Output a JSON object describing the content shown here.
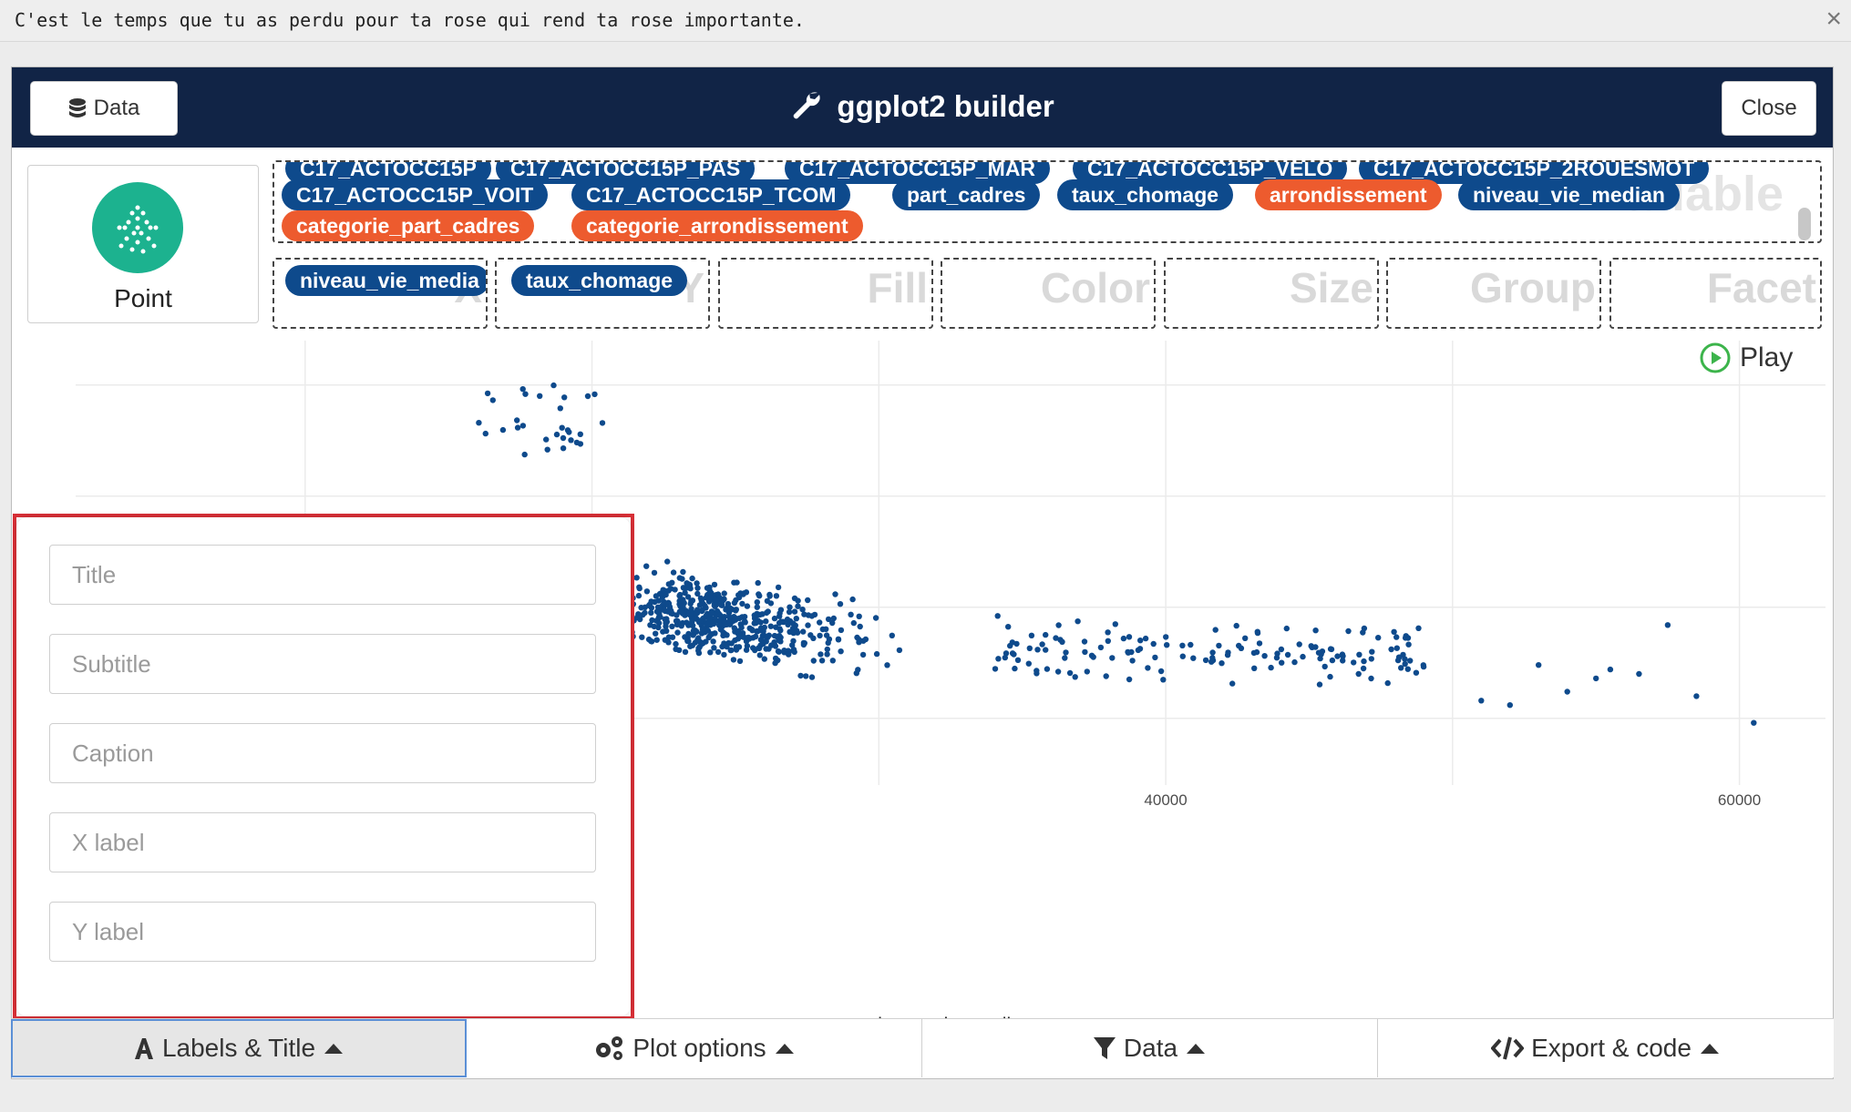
{
  "banner": {
    "text": "C'est le temps que tu as perdu pour ta rose qui rend ta rose importante.",
    "close_glyph": "×"
  },
  "header": {
    "title": "ggplot2 builder",
    "data_button": "Data",
    "close_button": "Close",
    "bg_color": "#112446"
  },
  "geom": {
    "label": "Point",
    "icon": "point-geom-icon",
    "color": "#1cb28f"
  },
  "variables": {
    "ghost_label": "ariable",
    "chips": [
      {
        "label": "C17_ACTOCC15P",
        "color": "blue"
      },
      {
        "label": "C17_ACTOCC15P_PAS",
        "color": "blue"
      },
      {
        "label": "C17_ACTOCC15P_MAR",
        "color": "blue"
      },
      {
        "label": "C17_ACTOCC15P_VELO",
        "color": "blue"
      },
      {
        "label": "C17_ACTOCC15P_2ROUESMOT",
        "color": "blue"
      },
      {
        "label": "C17_ACTOCC15P_VOIT",
        "color": "blue"
      },
      {
        "label": "C17_ACTOCC15P_TCOM",
        "color": "blue"
      },
      {
        "label": "part_cadres",
        "color": "blue"
      },
      {
        "label": "taux_chomage",
        "color": "blue"
      },
      {
        "label": "arrondissement",
        "color": "orange"
      },
      {
        "label": "niveau_vie_median",
        "color": "blue"
      },
      {
        "label": "categorie_part_cadres",
        "color": "orange"
      },
      {
        "label": "categorie_arrondissement",
        "color": "orange"
      }
    ]
  },
  "zones": {
    "x": {
      "label": "X",
      "chip": "niveau_vie_media"
    },
    "y": {
      "label": "Y",
      "chip": "taux_chomage"
    },
    "fill": {
      "label": "Fill"
    },
    "color": {
      "label": "Color"
    },
    "size": {
      "label": "Size"
    },
    "group": {
      "label": "Group"
    },
    "facet": {
      "label": "Facet"
    }
  },
  "play": {
    "label": "Play",
    "color": "#3cb44b"
  },
  "labels_panel": {
    "title_placeholder": "Title",
    "subtitle_placeholder": "Subtitle",
    "caption_placeholder": "Caption",
    "xlabel_placeholder": "X label",
    "ylabel_placeholder": "Y label",
    "border_color": "#d62f36"
  },
  "tabs": [
    {
      "label": "Labels & Title",
      "icon": "font-icon",
      "active": true
    },
    {
      "label": "Plot options",
      "icon": "gears-icon",
      "active": false
    },
    {
      "label": "Data",
      "icon": "filter-icon",
      "active": false
    },
    {
      "label": "Export & code",
      "icon": "code-icon",
      "active": false
    }
  ],
  "chart_data": {
    "type": "scatter",
    "xlabel": "niveau_vie_median",
    "ylabel": "",
    "x_ticks": [
      40000,
      60000
    ],
    "xlim": [
      2000,
      63000
    ],
    "ylim": [
      0,
      100
    ],
    "point_color": "#0e4a8c",
    "grid": true,
    "note": "~800 points; dense cluster at x 20000-32000, y 20-55"
  }
}
